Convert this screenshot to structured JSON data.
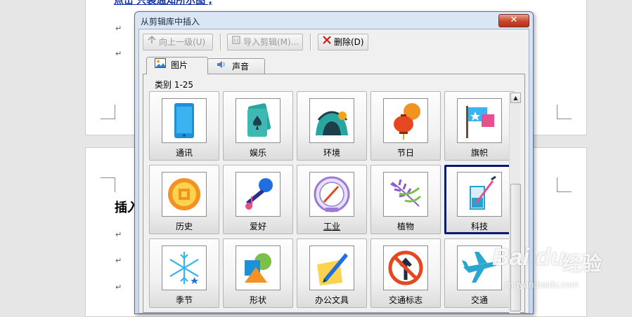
{
  "document": {
    "link_text": "点击'只装通知所示图',",
    "heading": "插入",
    "paragraph_mark": "↵"
  },
  "dialog": {
    "title": "从剪辑库中插入",
    "close_glyph": "✕"
  },
  "toolbar": {
    "up_label": "向上一级(U)",
    "import_label": "导入剪辑(M)...",
    "delete_label": "删除(D)"
  },
  "tabs": [
    {
      "label": "图片",
      "icon": "picture-icon",
      "active": true
    },
    {
      "label": "声音",
      "icon": "speaker-icon",
      "active": false
    }
  ],
  "category_label": "类别 1-25",
  "categories": [
    {
      "label": "通讯",
      "icon": "phone-icon"
    },
    {
      "label": "娱乐",
      "icon": "playing-card-icon"
    },
    {
      "label": "环境",
      "icon": "environment-icon"
    },
    {
      "label": "节日",
      "icon": "lantern-icon"
    },
    {
      "label": "旗帜",
      "icon": "flag-icon"
    },
    {
      "label": "历史",
      "icon": "coin-icon"
    },
    {
      "label": "爱好",
      "icon": "microphone-icon"
    },
    {
      "label": "工业",
      "icon": "gauge-icon"
    },
    {
      "label": "植物",
      "icon": "leaves-icon"
    },
    {
      "label": "科技",
      "icon": "beaker-icon",
      "selected": true
    },
    {
      "label": "季节",
      "icon": "snowflake-icon"
    },
    {
      "label": "形状",
      "icon": "shapes-icon"
    },
    {
      "label": "办公文具",
      "icon": "pen-paper-icon"
    },
    {
      "label": "交通标志",
      "icon": "traffic-sign-icon"
    },
    {
      "label": "交通",
      "icon": "airplane-icon"
    }
  ],
  "watermark": {
    "logo": "Bai du",
    "cn": "经验",
    "url": "jingyan.baidu.com"
  },
  "colors": {
    "selection_border": "#0b1a6e",
    "accent_red": "#d21b1b"
  }
}
